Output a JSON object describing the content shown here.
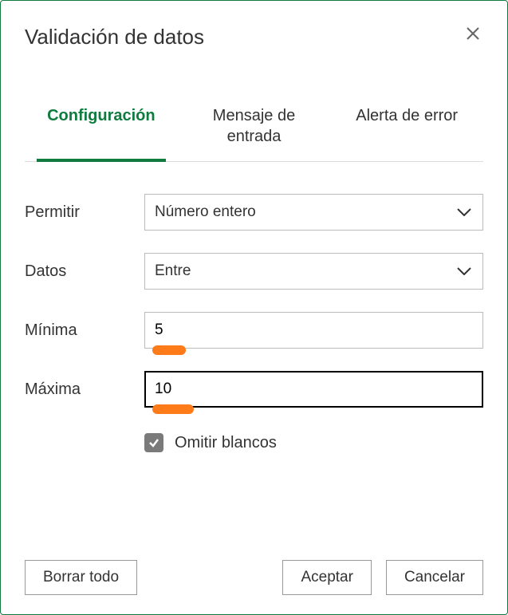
{
  "dialog": {
    "title": "Validación de datos"
  },
  "tabs": {
    "config": "Configuración",
    "input_msg_line1": "Mensaje de",
    "input_msg_line2": "entrada",
    "error_alert": "Alerta de error"
  },
  "fields": {
    "allow_label": "Permitir",
    "allow_value": "Número entero",
    "data_label": "Datos",
    "data_value": "Entre",
    "min_label": "Mínima",
    "min_value": "5",
    "max_label": "Máxima",
    "max_value": "10",
    "ignore_blank_label": "Omitir blancos"
  },
  "buttons": {
    "clear_all": "Borrar todo",
    "ok": "Aceptar",
    "cancel": "Cancelar"
  }
}
